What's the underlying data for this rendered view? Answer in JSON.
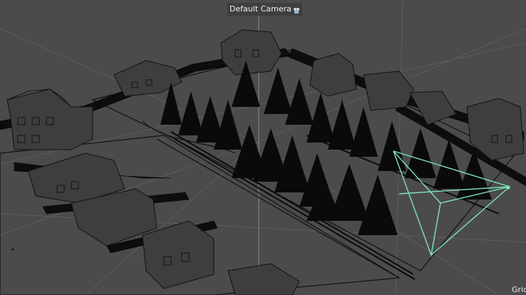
{
  "viewport": {
    "camera_label": "Default Camera",
    "camera_icon": "camera-selector-icon",
    "grid_label": "Grid"
  },
  "colors": {
    "background": "#4b4b4b",
    "wireframe": "#111111",
    "grid_line": "#5e5e5e",
    "camera_frustum": "#7fe3b8",
    "axis_line": "#8a8a8a"
  }
}
